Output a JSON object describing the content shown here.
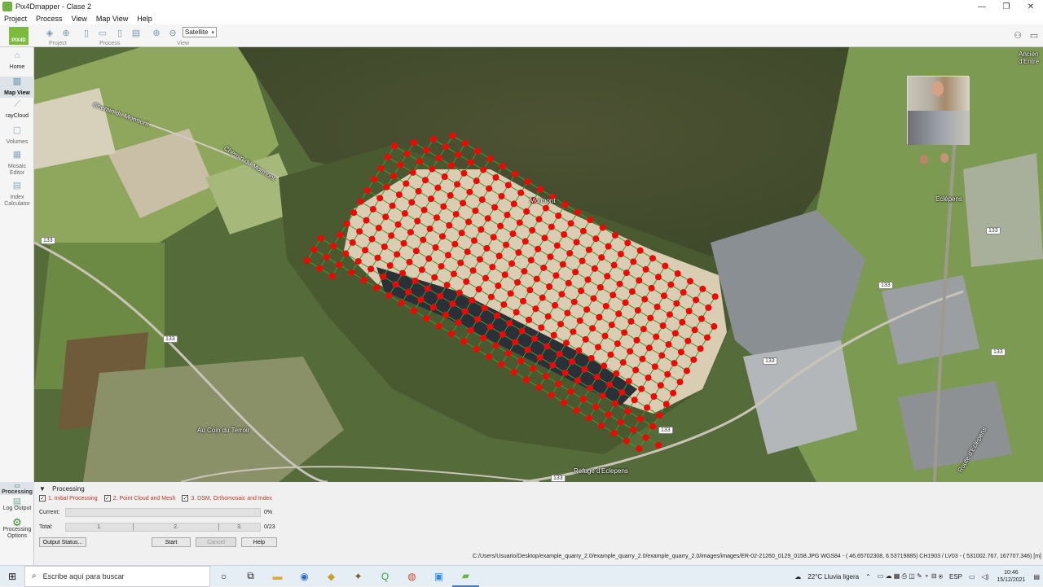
{
  "window": {
    "title": "Pix4Dmapper - Clase 2",
    "controls": [
      "—",
      "❐",
      "✕"
    ]
  },
  "menu": [
    "Project",
    "Process",
    "View",
    "Map View",
    "Help"
  ],
  "toolbar": {
    "groups": [
      "Project",
      "Process",
      "View"
    ],
    "map_type": "Satellite"
  },
  "sidebar": {
    "items": [
      {
        "label": "Home"
      },
      {
        "label": "Map View"
      },
      {
        "label": "rayCloud"
      },
      {
        "label": "Volumes"
      },
      {
        "label": "Mosaic Editor"
      },
      {
        "label": "Index Calculator"
      }
    ]
  },
  "map": {
    "labels": [
      "Chemin du Mormont",
      "Chemin du Mormont",
      "Au Coin du Terroir",
      "Refuge d'Eclepens",
      "Eclépens",
      "Ancien d'Entre",
      "Route d'Eclépens",
      "Mormont"
    ],
    "road_numbers": [
      "133",
      "133",
      "133",
      "133",
      "133",
      "133",
      "133",
      "133"
    ]
  },
  "processing": {
    "header": "Processing",
    "steps": [
      "1. Initial Processing",
      "2. Point Cloud and Mesh",
      "3. DSM, Orthomosaic and Index"
    ],
    "current_label": "Current:",
    "current_pct": "0%",
    "total_label": "Total:",
    "total_segments": [
      "1.",
      "2.",
      "3."
    ],
    "total_count": "0/23",
    "buttons": {
      "output_status": "Output Status...",
      "start": "Start",
      "cancel": "Cancel",
      "help": "Help"
    },
    "side": [
      "Processing",
      "Log Output",
      "Processing Options"
    ]
  },
  "statusbar": {
    "path": "C:/Users/Usuario/Desktop/example_quarry_2.0/example_quarry_2.0/example_quarry_2.0/images/images/ER-02-21260_0129_0158.JPG  WGS84 - ( 46.65702308,   6.53719885)  CH1903 / LV03 - (   531002.767,   167707.346) [m]"
  },
  "taskbar": {
    "search_placeholder": "Escribe aquí para buscar",
    "weather": "22°C  Lluvia ligera",
    "lang": "ESP",
    "time": "10:46",
    "date": "15/12/2021"
  },
  "colors": {
    "accent": "#6cb33f",
    "waypoint": "#ff0000",
    "flight_line": "#2fa32f",
    "step_text": "#c0392b"
  }
}
